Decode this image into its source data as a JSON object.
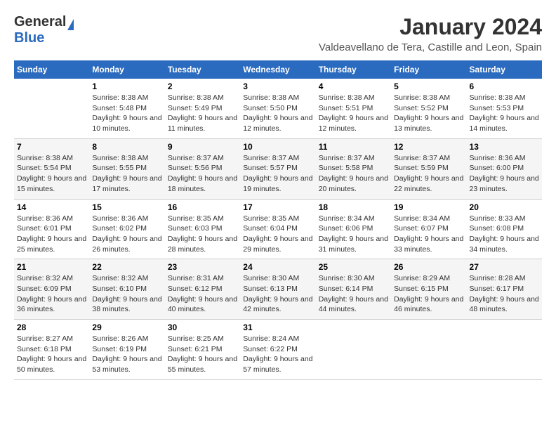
{
  "logo": {
    "general": "General",
    "blue": "Blue"
  },
  "title": "January 2024",
  "location": "Valdeavellano de Tera, Castille and Leon, Spain",
  "columns": [
    "Sunday",
    "Monday",
    "Tuesday",
    "Wednesday",
    "Thursday",
    "Friday",
    "Saturday"
  ],
  "weeks": [
    [
      {
        "day": "",
        "sunrise": "",
        "sunset": "",
        "daylight": ""
      },
      {
        "day": "1",
        "sunrise": "Sunrise: 8:38 AM",
        "sunset": "Sunset: 5:48 PM",
        "daylight": "Daylight: 9 hours and 10 minutes."
      },
      {
        "day": "2",
        "sunrise": "Sunrise: 8:38 AM",
        "sunset": "Sunset: 5:49 PM",
        "daylight": "Daylight: 9 hours and 11 minutes."
      },
      {
        "day": "3",
        "sunrise": "Sunrise: 8:38 AM",
        "sunset": "Sunset: 5:50 PM",
        "daylight": "Daylight: 9 hours and 12 minutes."
      },
      {
        "day": "4",
        "sunrise": "Sunrise: 8:38 AM",
        "sunset": "Sunset: 5:51 PM",
        "daylight": "Daylight: 9 hours and 12 minutes."
      },
      {
        "day": "5",
        "sunrise": "Sunrise: 8:38 AM",
        "sunset": "Sunset: 5:52 PM",
        "daylight": "Daylight: 9 hours and 13 minutes."
      },
      {
        "day": "6",
        "sunrise": "Sunrise: 8:38 AM",
        "sunset": "Sunset: 5:53 PM",
        "daylight": "Daylight: 9 hours and 14 minutes."
      }
    ],
    [
      {
        "day": "7",
        "sunrise": "Sunrise: 8:38 AM",
        "sunset": "Sunset: 5:54 PM",
        "daylight": "Daylight: 9 hours and 15 minutes."
      },
      {
        "day": "8",
        "sunrise": "Sunrise: 8:38 AM",
        "sunset": "Sunset: 5:55 PM",
        "daylight": "Daylight: 9 hours and 17 minutes."
      },
      {
        "day": "9",
        "sunrise": "Sunrise: 8:37 AM",
        "sunset": "Sunset: 5:56 PM",
        "daylight": "Daylight: 9 hours and 18 minutes."
      },
      {
        "day": "10",
        "sunrise": "Sunrise: 8:37 AM",
        "sunset": "Sunset: 5:57 PM",
        "daylight": "Daylight: 9 hours and 19 minutes."
      },
      {
        "day": "11",
        "sunrise": "Sunrise: 8:37 AM",
        "sunset": "Sunset: 5:58 PM",
        "daylight": "Daylight: 9 hours and 20 minutes."
      },
      {
        "day": "12",
        "sunrise": "Sunrise: 8:37 AM",
        "sunset": "Sunset: 5:59 PM",
        "daylight": "Daylight: 9 hours and 22 minutes."
      },
      {
        "day": "13",
        "sunrise": "Sunrise: 8:36 AM",
        "sunset": "Sunset: 6:00 PM",
        "daylight": "Daylight: 9 hours and 23 minutes."
      }
    ],
    [
      {
        "day": "14",
        "sunrise": "Sunrise: 8:36 AM",
        "sunset": "Sunset: 6:01 PM",
        "daylight": "Daylight: 9 hours and 25 minutes."
      },
      {
        "day": "15",
        "sunrise": "Sunrise: 8:36 AM",
        "sunset": "Sunset: 6:02 PM",
        "daylight": "Daylight: 9 hours and 26 minutes."
      },
      {
        "day": "16",
        "sunrise": "Sunrise: 8:35 AM",
        "sunset": "Sunset: 6:03 PM",
        "daylight": "Daylight: 9 hours and 28 minutes."
      },
      {
        "day": "17",
        "sunrise": "Sunrise: 8:35 AM",
        "sunset": "Sunset: 6:04 PM",
        "daylight": "Daylight: 9 hours and 29 minutes."
      },
      {
        "day": "18",
        "sunrise": "Sunrise: 8:34 AM",
        "sunset": "Sunset: 6:06 PM",
        "daylight": "Daylight: 9 hours and 31 minutes."
      },
      {
        "day": "19",
        "sunrise": "Sunrise: 8:34 AM",
        "sunset": "Sunset: 6:07 PM",
        "daylight": "Daylight: 9 hours and 33 minutes."
      },
      {
        "day": "20",
        "sunrise": "Sunrise: 8:33 AM",
        "sunset": "Sunset: 6:08 PM",
        "daylight": "Daylight: 9 hours and 34 minutes."
      }
    ],
    [
      {
        "day": "21",
        "sunrise": "Sunrise: 8:32 AM",
        "sunset": "Sunset: 6:09 PM",
        "daylight": "Daylight: 9 hours and 36 minutes."
      },
      {
        "day": "22",
        "sunrise": "Sunrise: 8:32 AM",
        "sunset": "Sunset: 6:10 PM",
        "daylight": "Daylight: 9 hours and 38 minutes."
      },
      {
        "day": "23",
        "sunrise": "Sunrise: 8:31 AM",
        "sunset": "Sunset: 6:12 PM",
        "daylight": "Daylight: 9 hours and 40 minutes."
      },
      {
        "day": "24",
        "sunrise": "Sunrise: 8:30 AM",
        "sunset": "Sunset: 6:13 PM",
        "daylight": "Daylight: 9 hours and 42 minutes."
      },
      {
        "day": "25",
        "sunrise": "Sunrise: 8:30 AM",
        "sunset": "Sunset: 6:14 PM",
        "daylight": "Daylight: 9 hours and 44 minutes."
      },
      {
        "day": "26",
        "sunrise": "Sunrise: 8:29 AM",
        "sunset": "Sunset: 6:15 PM",
        "daylight": "Daylight: 9 hours and 46 minutes."
      },
      {
        "day": "27",
        "sunrise": "Sunrise: 8:28 AM",
        "sunset": "Sunset: 6:17 PM",
        "daylight": "Daylight: 9 hours and 48 minutes."
      }
    ],
    [
      {
        "day": "28",
        "sunrise": "Sunrise: 8:27 AM",
        "sunset": "Sunset: 6:18 PM",
        "daylight": "Daylight: 9 hours and 50 minutes."
      },
      {
        "day": "29",
        "sunrise": "Sunrise: 8:26 AM",
        "sunset": "Sunset: 6:19 PM",
        "daylight": "Daylight: 9 hours and 53 minutes."
      },
      {
        "day": "30",
        "sunrise": "Sunrise: 8:25 AM",
        "sunset": "Sunset: 6:21 PM",
        "daylight": "Daylight: 9 hours and 55 minutes."
      },
      {
        "day": "31",
        "sunrise": "Sunrise: 8:24 AM",
        "sunset": "Sunset: 6:22 PM",
        "daylight": "Daylight: 9 hours and 57 minutes."
      },
      {
        "day": "",
        "sunrise": "",
        "sunset": "",
        "daylight": ""
      },
      {
        "day": "",
        "sunrise": "",
        "sunset": "",
        "daylight": ""
      },
      {
        "day": "",
        "sunrise": "",
        "sunset": "",
        "daylight": ""
      }
    ]
  ]
}
